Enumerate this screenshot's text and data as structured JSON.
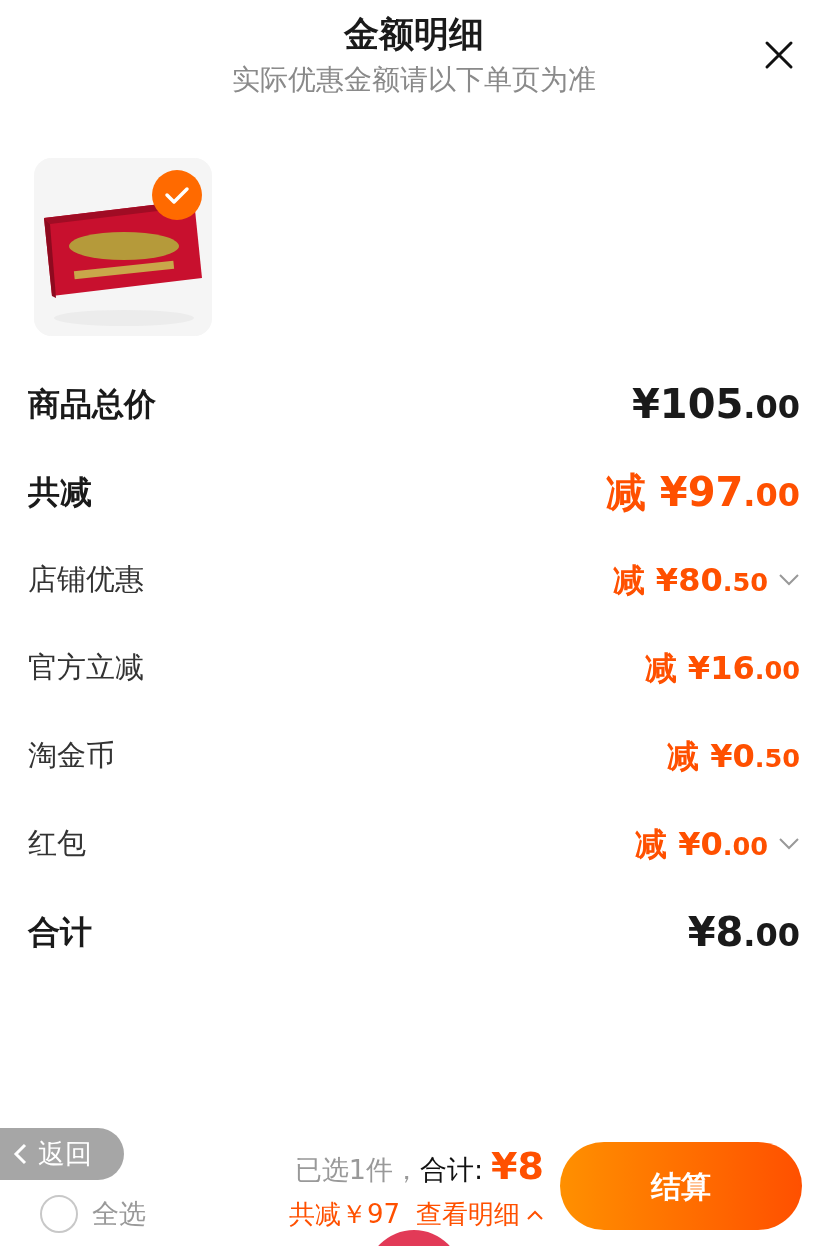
{
  "header": {
    "title": "金额明细",
    "subtitle": "实际优惠金额请以下单页为准"
  },
  "product": {
    "kind": "picture",
    "checked": true
  },
  "rows": [
    {
      "label": "商品总价",
      "kind": "header",
      "discount": false,
      "prefix": "",
      "amount": "¥105.00",
      "expandable": false
    },
    {
      "label": "共减",
      "kind": "header",
      "discount": true,
      "prefix": "减",
      "amount": "¥97.00",
      "expandable": false
    },
    {
      "label": "店铺优惠",
      "kind": "detail",
      "discount": true,
      "prefix": "减",
      "amount": "¥80.50",
      "expandable": true
    },
    {
      "label": "官方立减",
      "kind": "detail",
      "discount": true,
      "prefix": "减",
      "amount": "¥16.00",
      "expandable": false
    },
    {
      "label": "淘金币",
      "kind": "detail",
      "discount": true,
      "prefix": "减",
      "amount": "¥0.50",
      "expandable": false
    },
    {
      "label": "红包",
      "kind": "detail",
      "discount": true,
      "prefix": "减",
      "amount": "¥0.00",
      "expandable": true
    },
    {
      "label": "合计",
      "kind": "header",
      "discount": false,
      "prefix": "",
      "amount": "¥8.00",
      "expandable": false
    }
  ],
  "bottom_bar": {
    "select_all": {
      "label": "全选",
      "checked": false
    },
    "selected_count": "已选1件，",
    "total_label": "合计:",
    "total": "¥8",
    "saving": "共减￥97",
    "details_link": "查看明细",
    "checkout": "结算"
  },
  "back_button": {
    "label": "返回"
  }
}
